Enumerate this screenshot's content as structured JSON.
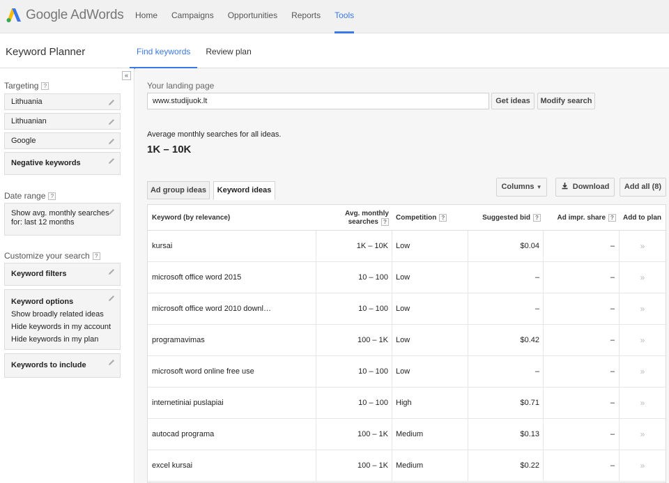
{
  "app": {
    "logo_text": "Google AdWords",
    "logo_icon": "adwords-logo-icon"
  },
  "topnav": {
    "items": [
      {
        "label": "Home"
      },
      {
        "label": "Campaigns"
      },
      {
        "label": "Opportunities"
      },
      {
        "label": "Reports"
      },
      {
        "label": "Tools",
        "active": true
      }
    ]
  },
  "page": {
    "title": "Keyword Planner",
    "tabs": [
      {
        "label": "Find keywords",
        "active": true
      },
      {
        "label": "Review plan"
      }
    ]
  },
  "sidebar": {
    "collapse_icon": "«",
    "targeting_label": "Targeting",
    "targeting": [
      {
        "label": "Lithuania"
      },
      {
        "label": "Lithuanian"
      },
      {
        "label": "Google"
      }
    ],
    "negative_keywords": "Negative keywords",
    "date_range_label": "Date range",
    "date_range_line1": "Show avg. monthly searches",
    "date_range_line2": "for: last 12 months",
    "customize_label": "Customize your search",
    "keyword_filters": "Keyword filters",
    "keyword_options": {
      "title": "Keyword options",
      "lines": [
        "Show broadly related ideas",
        "Hide keywords in my account",
        "Hide keywords in my plan"
      ]
    },
    "keywords_to_include": "Keywords to include",
    "help_icon_text": "?"
  },
  "main": {
    "landing_label": "Your landing page",
    "landing_value": "www.studijuok.lt",
    "get_ideas": "Get ideas",
    "modify_search": "Modify search",
    "avg_label": "Average monthly searches for all ideas.",
    "avg_value": "1K – 10K",
    "tabs": [
      {
        "label": "Ad group ideas"
      },
      {
        "label": "Keyword ideas",
        "active": true
      }
    ],
    "columns_btn": "Columns",
    "download_btn": "Download",
    "add_all_btn": "Add all (8)"
  },
  "table": {
    "headers": {
      "keyword": "Keyword (by relevance)",
      "avg_line1": "Avg. monthly",
      "avg_line2": "searches",
      "competition": "Competition",
      "bid": "Suggested bid",
      "impr": "Ad impr. share",
      "add": "Add to plan"
    },
    "rows": [
      {
        "keyword": "kursai",
        "avg": "1K – 10K",
        "competition": "Low",
        "bid": "$0.04",
        "impr": "–",
        "add": "»"
      },
      {
        "keyword": "microsoft office word 2015",
        "avg": "10 – 100",
        "competition": "Low",
        "bid": "–",
        "impr": "–",
        "add": "»"
      },
      {
        "keyword": "microsoft office word 2010 downl…",
        "avg": "10 – 100",
        "competition": "Low",
        "bid": "–",
        "impr": "–",
        "add": "»"
      },
      {
        "keyword": "programavimas",
        "avg": "100 – 1K",
        "competition": "Low",
        "bid": "$0.42",
        "impr": "–",
        "add": "»"
      },
      {
        "keyword": "microsoft word online free use",
        "avg": "10 – 100",
        "competition": "Low",
        "bid": "–",
        "impr": "–",
        "add": "»"
      },
      {
        "keyword": "internetiniai puslapiai",
        "avg": "10 – 100",
        "competition": "High",
        "bid": "$0.71",
        "impr": "–",
        "add": "»"
      },
      {
        "keyword": "autocad programa",
        "avg": "100 – 1K",
        "competition": "Medium",
        "bid": "$0.13",
        "impr": "–",
        "add": "»"
      },
      {
        "keyword": "excel kursai",
        "avg": "100 – 1K",
        "competition": "Medium",
        "bid": "$0.22",
        "impr": "–",
        "add": "»"
      }
    ]
  }
}
